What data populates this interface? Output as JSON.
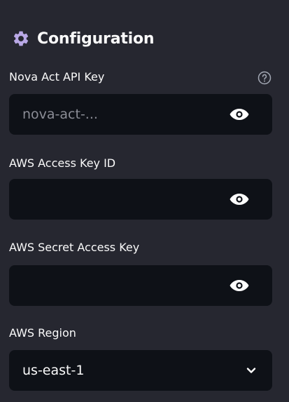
{
  "header": {
    "icon": "gear-icon",
    "title": "Configuration"
  },
  "fields": {
    "nova_key": {
      "label": "Nova Act API Key",
      "placeholder": "nova-act-...",
      "value": "",
      "help_icon": "help-circle-icon"
    },
    "aws_access_key": {
      "label": "AWS Access Key ID",
      "value": ""
    },
    "aws_secret_key": {
      "label": "AWS Secret Access Key",
      "value": ""
    },
    "aws_region": {
      "label": "AWS Region",
      "selected": "us-east-1"
    }
  },
  "colors": {
    "background": "#262730",
    "input_background": "#0e1117",
    "text": "#fafafa",
    "placeholder": "#8b8d96"
  }
}
